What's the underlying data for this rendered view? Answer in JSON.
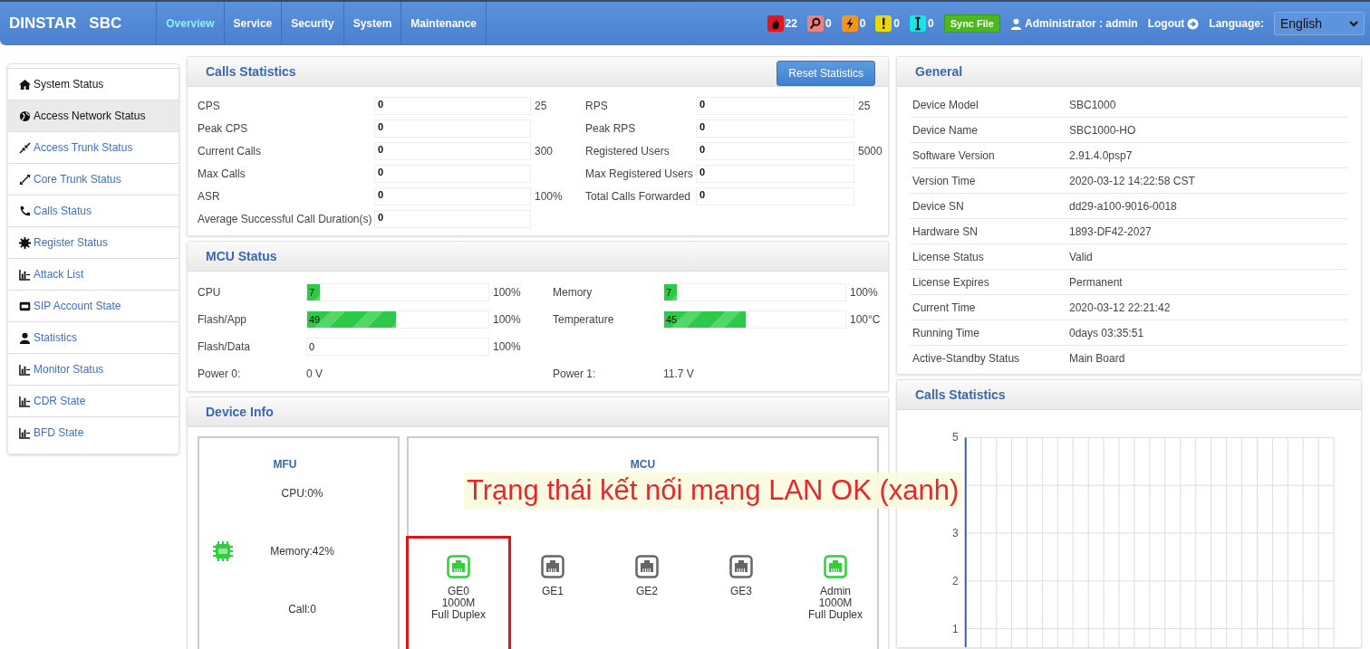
{
  "header": {
    "logo": "DINSTAR",
    "product": "SBC",
    "nav": [
      {
        "label": "Overview",
        "selected": true
      },
      {
        "label": "Service",
        "selected": false
      },
      {
        "label": "Security",
        "selected": false
      },
      {
        "label": "System",
        "selected": false
      },
      {
        "label": "Maintenance",
        "selected": false
      }
    ],
    "alarms": [
      {
        "kind": "fire",
        "count": "22",
        "color": "#e8141b"
      },
      {
        "kind": "key",
        "count": "0",
        "color": "#f08080"
      },
      {
        "kind": "bolt",
        "count": "0",
        "color": "#f7941d"
      },
      {
        "kind": "exclamation",
        "count": "0",
        "color": "#e8d90c"
      },
      {
        "kind": "cursor",
        "count": "0",
        "color": "#16e6e6"
      }
    ],
    "sync_button": "Sync File",
    "user": "Administrator : admin",
    "logout": "Logout",
    "language_label": "Language:",
    "language": "English"
  },
  "sidebar": {
    "items": [
      {
        "label": "System Status",
        "kind": "title",
        "selected": false
      },
      {
        "label": "Access Network Status",
        "kind": "link",
        "selected": true
      },
      {
        "label": "Access Trunk Status",
        "kind": "link",
        "selected": false
      },
      {
        "label": "Core Trunk Status",
        "kind": "link",
        "selected": false
      },
      {
        "label": "Calls Status",
        "kind": "link",
        "selected": false
      },
      {
        "label": "Register Status",
        "kind": "link",
        "selected": false
      },
      {
        "label": "Attack List",
        "kind": "link",
        "selected": false
      },
      {
        "label": "SIP Account State",
        "kind": "link",
        "selected": false
      },
      {
        "label": "Statistics",
        "kind": "link",
        "selected": false
      },
      {
        "label": "Monitor Status",
        "kind": "link",
        "selected": false
      },
      {
        "label": "CDR State",
        "kind": "link",
        "selected": false
      },
      {
        "label": "BFD State",
        "kind": "link",
        "selected": false
      }
    ]
  },
  "calls_statistics": {
    "title": "Calls Statistics",
    "reset_button": "Reset Statistics",
    "rows": [
      [
        {
          "label": "CPS",
          "value": "0",
          "max": "25"
        },
        {
          "label": "RPS",
          "value": "0",
          "max": "25"
        }
      ],
      [
        {
          "label": "Peak CPS",
          "value": "0"
        },
        {
          "label": "Peak RPS",
          "value": "0"
        }
      ],
      [
        {
          "label": "Current Calls",
          "value": "0",
          "max": "300"
        },
        {
          "label": "Registered Users",
          "value": "0",
          "max": "5000"
        }
      ],
      [
        {
          "label": "Max Calls",
          "value": "0"
        },
        {
          "label": "Max Registered Users",
          "value": "0"
        }
      ],
      [
        {
          "label": "ASR",
          "value": "0",
          "max": "100%"
        },
        {
          "label": "Total Calls Forwarded",
          "value": "0"
        }
      ],
      [
        {
          "label": "Average Successful Call Duration(s)",
          "value": "0"
        }
      ]
    ]
  },
  "mcu_status": {
    "title": "MCU Status",
    "rows": [
      [
        {
          "kind": "bar",
          "label": "CPU",
          "value": "7",
          "level": 0.07,
          "max": "100%"
        },
        {
          "kind": "bar",
          "label": "Memory",
          "value": "7",
          "level": 0.07,
          "max": "100%"
        }
      ],
      [
        {
          "kind": "bar",
          "label": "Flash/App",
          "value": "49",
          "level": 0.49,
          "max": "100%"
        },
        {
          "kind": "bar",
          "label": "Temperature",
          "value": "45",
          "level": 0.45,
          "max": "100°C"
        }
      ],
      [
        {
          "kind": "bar",
          "label": "Flash/Data",
          "value": "0",
          "level": 0,
          "max": "100%"
        }
      ],
      [
        {
          "kind": "text",
          "label": "Power 0:",
          "value": "0 V"
        },
        {
          "kind": "text",
          "label": "Power 1:",
          "value": "11.7 V"
        }
      ]
    ]
  },
  "device_info": {
    "title": "Device Info",
    "mfu": {
      "title": "MFU",
      "stats": [
        "CPU:0%",
        "Memory:42%",
        "Call:0"
      ]
    },
    "mcu": {
      "title": "MCU",
      "ports": [
        {
          "lines": [
            "GE0",
            "1000M",
            "Full Duplex"
          ],
          "on": true,
          "highlighted": true
        },
        {
          "lines": [
            "GE1"
          ],
          "on": false
        },
        {
          "lines": [
            "GE2"
          ],
          "on": false
        },
        {
          "lines": [
            "GE3"
          ],
          "on": false
        },
        {
          "lines": [
            "Admin",
            "1000M",
            "Full Duplex"
          ],
          "on": true
        }
      ]
    }
  },
  "general": {
    "title": "General",
    "rows": [
      [
        "Device Model",
        "SBC1000"
      ],
      [
        "Device Name",
        "SBC1000-HO"
      ],
      [
        "Software Version",
        "2.91.4.0psp7"
      ],
      [
        "Version Time",
        "2020-03-12 14:22:58 CST"
      ],
      [
        "Device SN",
        "dd29-a100-9016-0018"
      ],
      [
        "Hardware SN",
        "1893-DF42-2027"
      ],
      [
        "License Status",
        "Valid"
      ],
      [
        "License Expires",
        "Permanent"
      ],
      [
        "Current Time",
        "2020-03-12 22:21:42"
      ],
      [
        "Running Time",
        "0days 03:35:51"
      ],
      [
        "Active-Standby Status",
        "Main Board"
      ]
    ]
  },
  "calls_chart": {
    "title": "Calls Statistics",
    "axis_labels": [
      "5",
      "3",
      "2",
      "1"
    ]
  },
  "annotation": {
    "text": "Trạng thái kết nối mạng LAN OK (xanh)"
  }
}
